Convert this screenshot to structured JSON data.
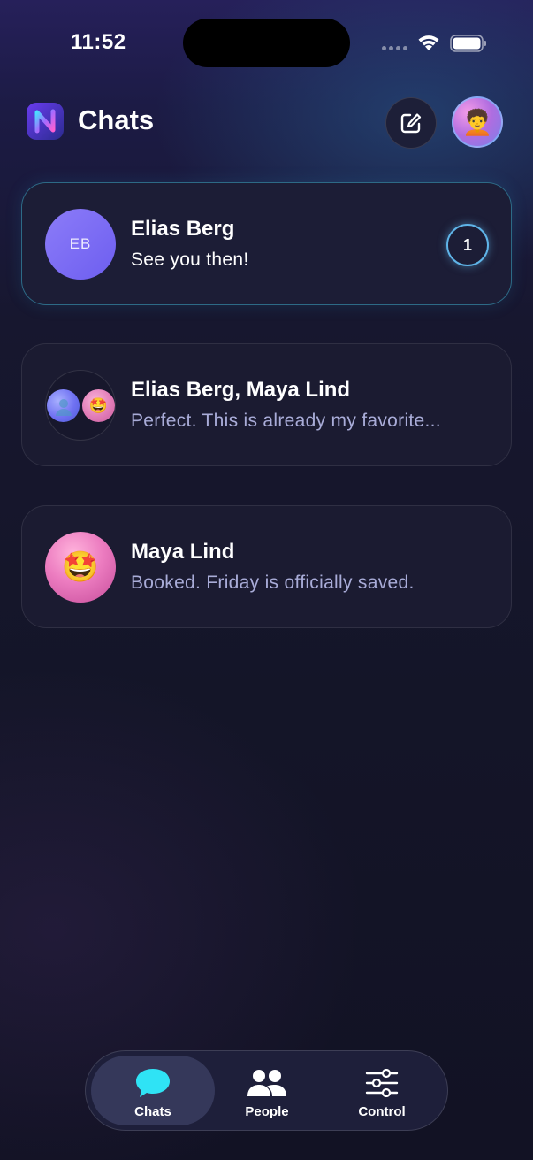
{
  "status_bar": {
    "time": "11:52"
  },
  "header": {
    "title": "Chats",
    "logo_icon": "n-logo-icon",
    "compose_icon": "compose-icon",
    "profile_avatar_emoji": "🧑‍🦱"
  },
  "chats": [
    {
      "name": "Elias Berg",
      "preview": "See you then!",
      "avatar_initials": "EB",
      "unread_count": "1",
      "active": true
    },
    {
      "name": "Elias Berg, Maya Lind",
      "preview": "Perfect. This is already my favorite...",
      "mini_avatar_b_emoji": "🤩",
      "active": false
    },
    {
      "name": "Maya Lind",
      "preview": "Booked. Friday is officially saved.",
      "avatar_emoji": "🤩",
      "active": false
    }
  ],
  "tab_bar": {
    "tabs": [
      {
        "label": "Chats",
        "icon": "chat-bubble-icon",
        "active": true
      },
      {
        "label": "People",
        "icon": "people-icon",
        "active": false
      },
      {
        "label": "Control",
        "icon": "sliders-icon",
        "active": false
      }
    ]
  },
  "colors": {
    "accent_cyan": "#2fe3f5",
    "badge_ring": "#5fb4e8",
    "preview_muted": "#a9acd8",
    "card_bg": "#1b1b31"
  }
}
